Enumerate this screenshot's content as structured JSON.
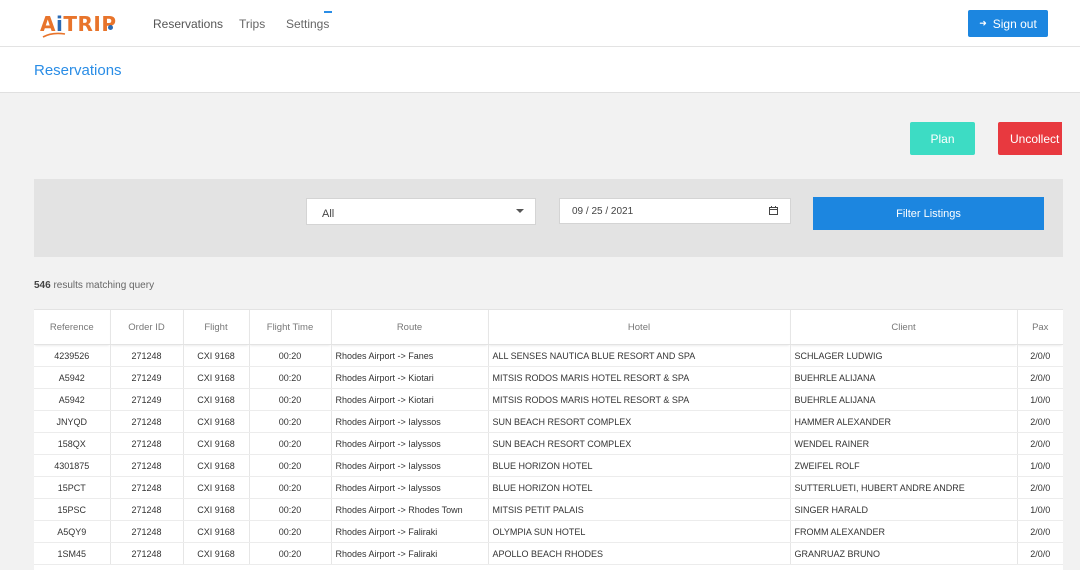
{
  "app": {
    "logo_text": "AiTRIP",
    "nav": [
      {
        "label": "Reservations",
        "active": true
      },
      {
        "label": "Trips",
        "active": false
      },
      {
        "label": "Settings",
        "active": false
      }
    ],
    "signout_label": "Sign out"
  },
  "page": {
    "title": "Reservations"
  },
  "actions": {
    "plan_label": "Plan",
    "uncollect_label": "Uncollect A"
  },
  "filters": {
    "select_value": "All",
    "date_value": "09 / 25 / 2021",
    "filter_button_label": "Filter Listings"
  },
  "results": {
    "count": "546",
    "suffix": "results matching query"
  },
  "table": {
    "columns": [
      "Reference",
      "Order ID",
      "Flight",
      "Flight Time",
      "Route",
      "Hotel",
      "Client",
      "Pax"
    ],
    "rows": [
      [
        "4239526",
        "271248",
        "CXI 9168",
        "00:20",
        "Rhodes Airport -> Fanes",
        "ALL SENSES NAUTICA BLUE RESORT AND SPA",
        "SCHLAGER LUDWIG",
        "2/0/0"
      ],
      [
        "A5942",
        "271249",
        "CXI 9168",
        "00:20",
        "Rhodes Airport -> Kiotari",
        "MITSIS RODOS MARIS HOTEL RESORT & SPA",
        "BUEHRLE ALIJANA",
        "2/0/0"
      ],
      [
        "A5942",
        "271249",
        "CXI 9168",
        "00:20",
        "Rhodes Airport -> Kiotari",
        "MITSIS RODOS MARIS HOTEL RESORT & SPA",
        "BUEHRLE ALIJANA",
        "1/0/0"
      ],
      [
        "JNYQD",
        "271248",
        "CXI 9168",
        "00:20",
        "Rhodes Airport -> Ialyssos",
        "SUN BEACH RESORT COMPLEX",
        "HAMMER ALEXANDER",
        "2/0/0"
      ],
      [
        "158QX",
        "271248",
        "CXI 9168",
        "00:20",
        "Rhodes Airport -> Ialyssos",
        "SUN BEACH RESORT COMPLEX",
        "WENDEL RAINER",
        "2/0/0"
      ],
      [
        "4301875",
        "271248",
        "CXI 9168",
        "00:20",
        "Rhodes Airport -> Ialyssos",
        "BLUE HORIZON HOTEL",
        "ZWEIFEL ROLF",
        "1/0/0"
      ],
      [
        "15PCT",
        "271248",
        "CXI 9168",
        "00:20",
        "Rhodes Airport -> Ialyssos",
        "BLUE HORIZON HOTEL",
        "SUTTERLUETI, HUBERT ANDRE ANDRE",
        "2/0/0"
      ],
      [
        "15PSC",
        "271248",
        "CXI 9168",
        "00:20",
        "Rhodes Airport -> Rhodes Town",
        "MITSIS PETIT PALAIS",
        "SINGER HARALD",
        "1/0/0"
      ],
      [
        "A5QY9",
        "271248",
        "CXI 9168",
        "00:20",
        "Rhodes Airport -> Faliraki",
        "OLYMPIA SUN HOTEL",
        "FROMM ALEXANDER",
        "2/0/0"
      ],
      [
        "1SM45",
        "271248",
        "CXI 9168",
        "00:20",
        "Rhodes Airport -> Faliraki",
        "APOLLO BEACH RHODES",
        "GRANRUAZ BRUNO",
        "2/0/0"
      ]
    ]
  },
  "colors": {
    "accent": "#1c86e0",
    "plan": "#3ddcc4",
    "uncollect": "#e8393f",
    "title": "#2a8de6"
  }
}
